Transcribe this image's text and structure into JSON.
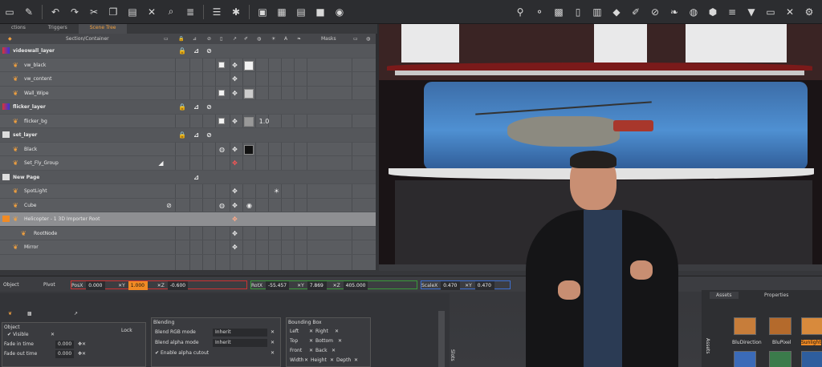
{
  "tabs": [
    "ctions",
    "Triggers",
    "Scene Tree"
  ],
  "tree": {
    "header": {
      "section": "Section/Container",
      "masks": "Masks"
    },
    "rows": [
      {
        "label": "videowall_layer",
        "type": "layer"
      },
      {
        "label": "vw_black",
        "type": "item"
      },
      {
        "label": "vw_content",
        "type": "item"
      },
      {
        "label": "Wall_Wipe",
        "type": "item"
      },
      {
        "label": "flicker_layer",
        "type": "layer"
      },
      {
        "label": "flicker_bg",
        "type": "item"
      },
      {
        "label": "set_layer",
        "type": "layer"
      },
      {
        "label": "Black",
        "type": "item"
      },
      {
        "label": "Set_Fly_Group",
        "type": "item"
      },
      {
        "label": "New Page",
        "type": "layer"
      },
      {
        "label": "SpotLight",
        "type": "item"
      },
      {
        "label": "Cube",
        "type": "item"
      },
      {
        "label": "Helicopter - 1 3D Importer Root",
        "type": "selected"
      },
      {
        "label": "RootNode",
        "type": "item"
      },
      {
        "label": "Mirror",
        "type": "item"
      }
    ],
    "flicker_value": "1.0"
  },
  "transform": {
    "object_label": "Object",
    "pivot_label": "Pivot",
    "pos": {
      "label": "PosX",
      "x": "0.000",
      "y": "1.000",
      "z": "-0.600"
    },
    "rot": {
      "label": "RotX",
      "x": "-55.457",
      "y": "7.869",
      "z": "405.000"
    },
    "scale": {
      "label": "ScaleX",
      "x": "0.470",
      "y": "0.470"
    }
  },
  "props": {
    "object_title": "Object",
    "visible": "Visible",
    "lock": "Lock",
    "fade_in": {
      "label": "Fade in time",
      "value": "0.000"
    },
    "fade_out": {
      "label": "Fade out time",
      "value": "0.000"
    },
    "blending_title": "Blending",
    "blend_rgb": {
      "label": "Blend RGB mode",
      "value": "Inherit"
    },
    "blend_alpha": {
      "label": "Blend alpha mode",
      "value": "Inherit"
    },
    "alpha_cutout": "Enable alpha cutout",
    "bbox_title": "Bounding Box",
    "bbox": [
      "Left",
      "Right",
      "Top",
      "Bottom",
      "Front",
      "Back",
      "Width",
      "Height",
      "Depth"
    ],
    "slot_label": "Slots"
  },
  "assets": {
    "tabs": [
      "Assets",
      "Properties"
    ],
    "thumbs": [
      "BluDirection",
      "BluPixel",
      "Sunlight"
    ],
    "side_label": "Assets"
  },
  "colors": {
    "accent": "#f08a24",
    "selected_row": "#8e8f92",
    "pos_border": "#cc3333",
    "rot_border": "#3a9a3a",
    "scale_border": "#3e6fd0"
  }
}
